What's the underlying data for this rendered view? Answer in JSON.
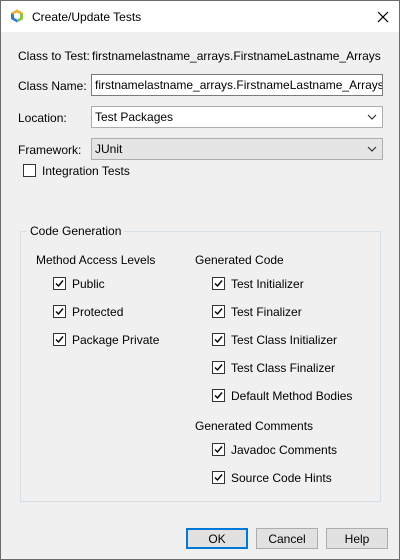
{
  "window": {
    "title": "Create/Update Tests",
    "icon": "netbeans-hexagon-icon"
  },
  "form": {
    "class_to_test_label": "Class to Test:",
    "class_to_test_value": "firstnamelastname_arrays.FirstnameLastname_Arrays",
    "class_name_label": "Class Name:",
    "class_name_value": "firstnamelastname_arrays.FirstnameLastname_ArraysTest",
    "location_label": "Location:",
    "location_value": "Test Packages",
    "framework_label": "Framework:",
    "framework_value": "JUnit",
    "integration_tests_label": "Integration Tests",
    "integration_tests_checked": false
  },
  "code_generation": {
    "title": "Code Generation",
    "method_access_title": "Method Access Levels",
    "method_access": [
      {
        "label": "Public",
        "checked": true
      },
      {
        "label": "Protected",
        "checked": true
      },
      {
        "label": "Package Private",
        "checked": true
      }
    ],
    "generated_code_title": "Generated Code",
    "generated_code": [
      {
        "label": "Test Initializer",
        "checked": true
      },
      {
        "label": "Test Finalizer",
        "checked": true
      },
      {
        "label": "Test Class Initializer",
        "checked": true
      },
      {
        "label": "Test Class Finalizer",
        "checked": true
      },
      {
        "label": "Default Method Bodies",
        "checked": true
      }
    ],
    "generated_comments_title": "Generated Comments",
    "generated_comments": [
      {
        "label": "Javadoc Comments",
        "checked": true
      },
      {
        "label": "Source Code Hints",
        "checked": true
      }
    ]
  },
  "buttons": {
    "ok": "OK",
    "cancel": "Cancel",
    "help": "Help"
  }
}
